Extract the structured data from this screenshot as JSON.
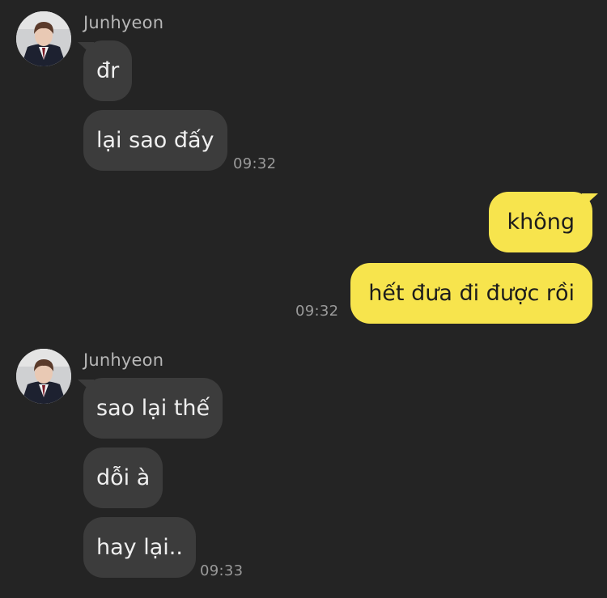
{
  "chat": {
    "groups": [
      {
        "sender": "Junhyeon",
        "avatar_icon": "user-avatar",
        "messages": [
          "đr",
          "lại sao đấy"
        ],
        "time": "09:32"
      },
      {
        "sender": "me",
        "messages": [
          "không",
          "hết đưa đi được rồi"
        ],
        "time": "09:32"
      },
      {
        "sender": "Junhyeon",
        "avatar_icon": "user-avatar",
        "messages": [
          "sao lại thế",
          "dỗi à",
          "hay lại.."
        ],
        "time": "09:33"
      }
    ]
  },
  "theme": {
    "background": "#242424",
    "incoming_bubble": "#3c3c3c",
    "outgoing_bubble": "#f7e44d"
  }
}
